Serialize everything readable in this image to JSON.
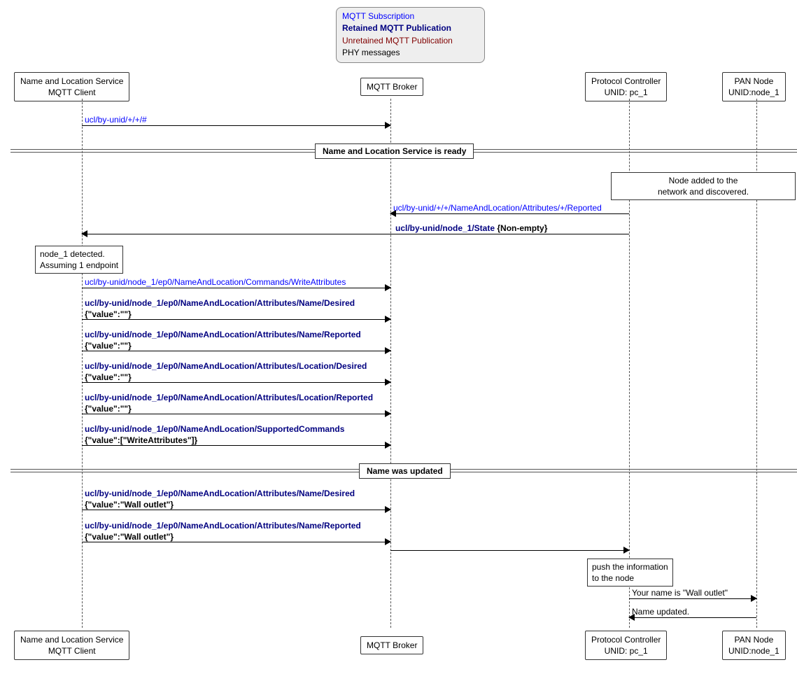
{
  "legend": {
    "subscription": "MQTT Subscription",
    "retained": "Retained MQTT Publication",
    "unretained": "Unretained MQTT Publication",
    "phy": "PHY messages"
  },
  "participants": {
    "p1_l1": "Name and Location Service",
    "p1_l2": "MQTT Client",
    "p2": "MQTT Broker",
    "p3_l1": "Protocol Controller",
    "p3_l2": "UNID: pc_1",
    "p4_l1": "PAN Node",
    "p4_l2": "UNID:node_1"
  },
  "dividers": {
    "d1": "Name and Location Service is ready",
    "d2": "Name was updated"
  },
  "notes": {
    "n1_l1": "Node added to the",
    "n1_l2": "network and discovered.",
    "n2_l1": "node_1 detected.",
    "n2_l2": "Assuming 1 endpoint",
    "n3_l1": "push the information",
    "n3_l2": "to the node"
  },
  "messages": {
    "m1": "ucl/by-unid/+/+/#",
    "m2": "ucl/by-unid/+/+/NameAndLocation/Attributes/+/Reported",
    "m3_t": "ucl/by-unid/node_1/State",
    "m3_p": "{Non-empty}",
    "m4": "ucl/by-unid/node_1/ep0/NameAndLocation/Commands/WriteAttributes",
    "m5_t": "ucl/by-unid/node_1/ep0/NameAndLocation/Attributes/Name/Desired",
    "m5_p": "{\"value\":\"\"}",
    "m6_t": "ucl/by-unid/node_1/ep0/NameAndLocation/Attributes/Name/Reported",
    "m6_p": "{\"value\":\"\"}",
    "m7_t": "ucl/by-unid/node_1/ep0/NameAndLocation/Attributes/Location/Desired",
    "m7_p": "{\"value\":\"\"}",
    "m8_t": "ucl/by-unid/node_1/ep0/NameAndLocation/Attributes/Location/Reported",
    "m8_p": "{\"value\":\"\"}",
    "m9_t": "ucl/by-unid/node_1/ep0/NameAndLocation/SupportedCommands",
    "m9_p": "{\"value\":[\"WriteAttributes\"]}",
    "m10_t": "ucl/by-unid/node_1/ep0/NameAndLocation/Attributes/Name/Desired",
    "m10_p": "{\"value\":\"Wall outlet\"}",
    "m11_t": "ucl/by-unid/node_1/ep0/NameAndLocation/Attributes/Name/Reported",
    "m11_p": "{\"value\":\"Wall outlet\"}",
    "m12": "Your name is \"Wall outlet\"",
    "m13": "Name updated."
  }
}
